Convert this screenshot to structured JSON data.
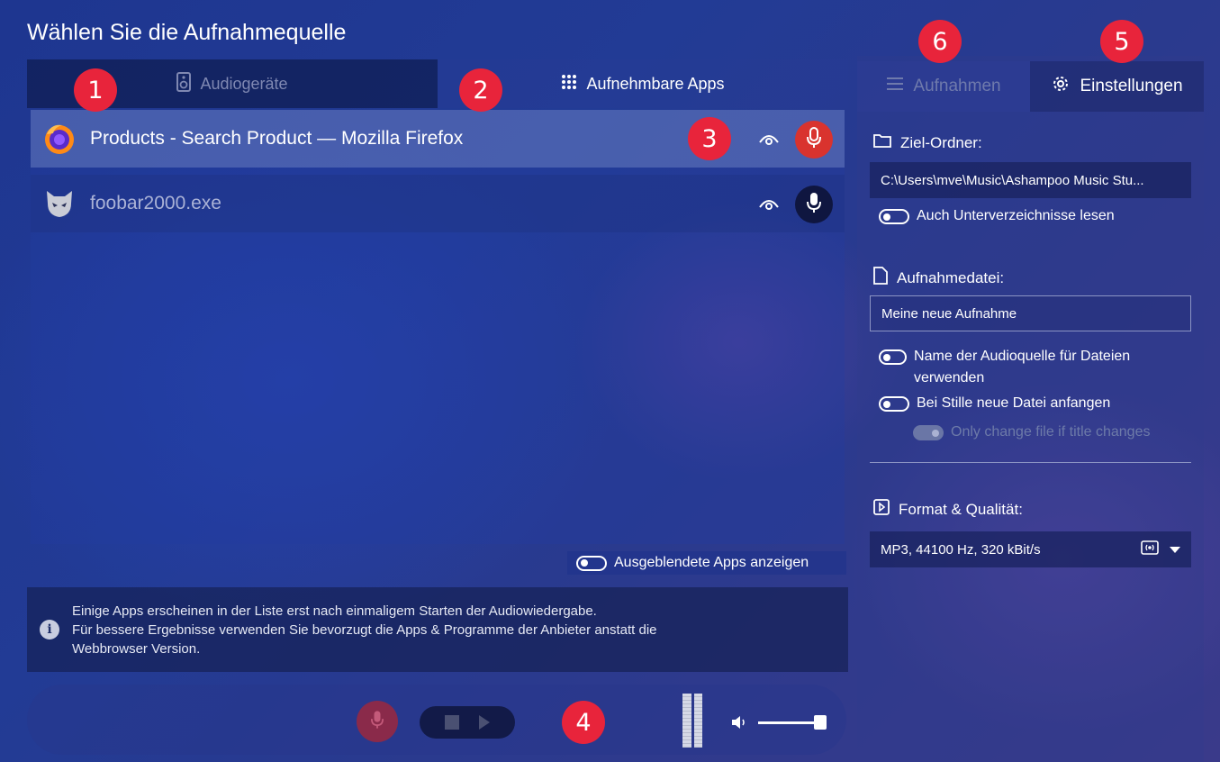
{
  "page": {
    "title": "Wählen Sie die Aufnahmequelle"
  },
  "source_tabs": [
    {
      "label": "Audiogeräte",
      "icon": "speaker-icon",
      "active": false
    },
    {
      "label": "Aufnehmbare Apps",
      "icon": "grid-icon",
      "active": true
    }
  ],
  "apps": [
    {
      "name": "Products - Search Product — Mozilla Firefox",
      "icon": "firefox-icon",
      "recording": true
    },
    {
      "name": "foobar2000.exe",
      "icon": "foobar-icon",
      "recording": false
    }
  ],
  "hidden_apps_toggle": {
    "label": "Ausgeblendete Apps anzeigen",
    "on": false
  },
  "info": {
    "lines": [
      "Einige Apps erscheinen in der Liste erst nach einmaligem Starten der Audiowiedergabe.",
      "Für bessere Ergebnisse verwenden Sie bevorzugt die Apps & Programme der Anbieter anstatt die",
      "Webbrowser Version."
    ]
  },
  "right_tabs": [
    {
      "label": "Aufnahmen",
      "icon": "list-icon",
      "active": false
    },
    {
      "label": "Einstellungen",
      "icon": "gear-icon",
      "active": true
    }
  ],
  "settings": {
    "target_folder": {
      "label": "Ziel-Ordner:",
      "value": "C:\\Users\\mve\\Music\\Ashampoo Music Stu...",
      "subfolders_toggle": "Auch Unterverzeichnisse lesen"
    },
    "recording_file": {
      "label": "Aufnahmedatei:",
      "value": "Meine neue Aufnahme",
      "source_name_toggle": "Name der Audioquelle für Dateien verwenden",
      "silence_toggle": "Bei Stille neue Datei anfangen",
      "title_change_toggle": "Only change file if title changes"
    },
    "format": {
      "label": "Format & Qualität:",
      "value": "MP3, 44100 Hz, 320 kBit/s"
    }
  },
  "player": {
    "volume_level": 0.9
  },
  "annotations": [
    "1",
    "2",
    "3",
    "4",
    "5",
    "6"
  ],
  "colors": {
    "accent_red": "#d9332e",
    "badge_red": "#e8243b",
    "background": "#223b95"
  }
}
